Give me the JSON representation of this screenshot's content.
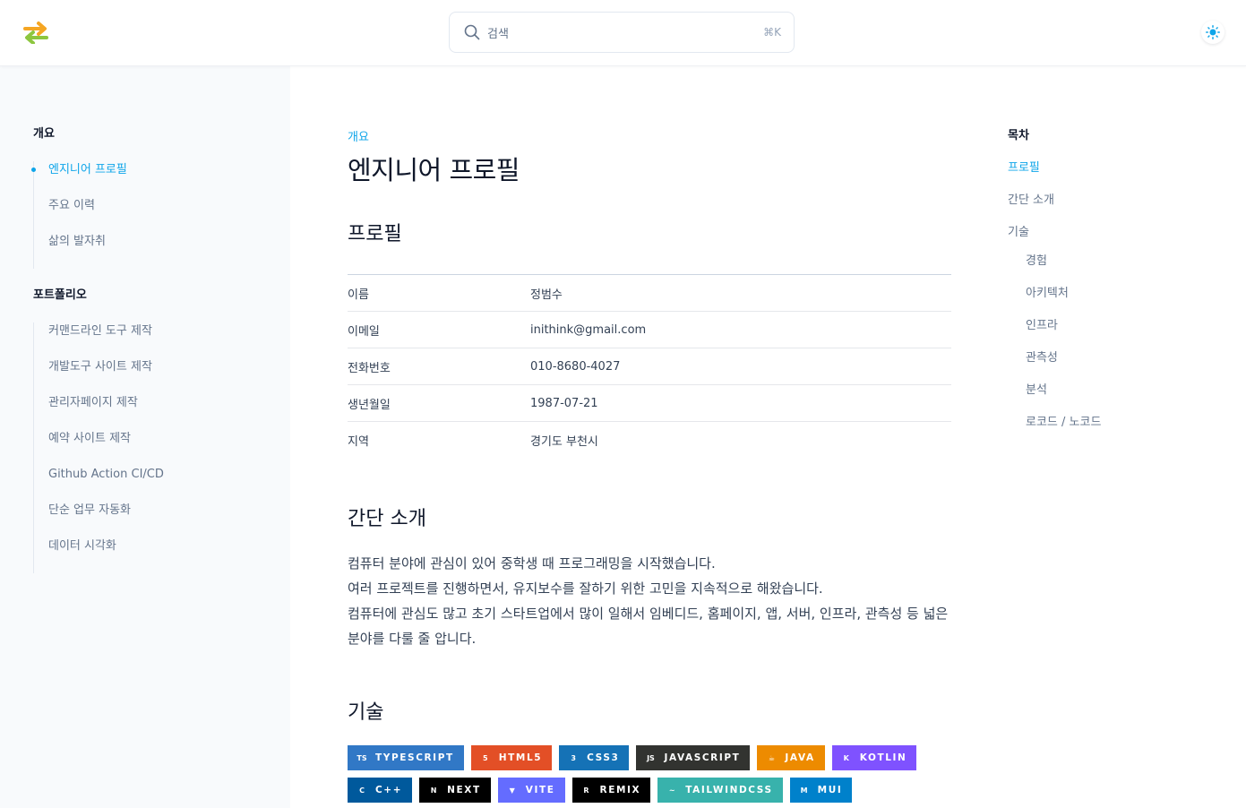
{
  "header": {
    "logo_name": "swap-arrows-logo",
    "search": {
      "placeholder": "검색",
      "shortcut": "⌘K"
    },
    "theme_icon": "sun-icon"
  },
  "sidebar": {
    "sections": [
      {
        "heading": "개요",
        "items": [
          {
            "label": "엔지니어 프로필",
            "active": true
          },
          {
            "label": "주요 이력"
          },
          {
            "label": "삶의 발자취"
          }
        ]
      },
      {
        "heading": "포트폴리오",
        "items": [
          {
            "label": "커맨드라인 도구 제작"
          },
          {
            "label": "개발도구 사이트 제작"
          },
          {
            "label": "관리자페이지 제작"
          },
          {
            "label": "예약 사이트 제작"
          },
          {
            "label": "Github Action CI/CD"
          },
          {
            "label": "단순 업무 자동화"
          },
          {
            "label": "데이터 시각화"
          }
        ]
      }
    ]
  },
  "main": {
    "eyebrow": "개요",
    "title": "엔지니어 프로필",
    "profile_heading": "프로필",
    "profile_rows": [
      {
        "key": "이름",
        "value": "정범수"
      },
      {
        "key": "이메일",
        "value": "inithink@gmail.com"
      },
      {
        "key": "전화번호",
        "value": "010-8680-4027"
      },
      {
        "key": "생년월일",
        "value": "1987-07-21"
      },
      {
        "key": "지역",
        "value": "경기도 부천시"
      }
    ],
    "intro_heading": "간단 소개",
    "intro_lines": [
      "컴퓨터 분야에 관심이 있어 중학생 때 프로그래밍을 시작했습니다.",
      "여러 프로젝트를 진행하면서, 유지보수를 잘하기 위한 고민을 지속적으로 해왔습니다.",
      "컴퓨터에 관심도 많고 초기 스타트업에서 많이 일해서 임베디드, 홈페이지, 앱, 서버, 인프라, 관측성 등 넓은",
      "분야를 다룰 줄 압니다."
    ],
    "tech_heading": "기술",
    "badges": [
      [
        {
          "label": "TYPESCRIPT",
          "color": "#3178c6",
          "icon": "typescript-icon",
          "glyph": "TS"
        },
        {
          "label": "HTML5",
          "color": "#e34f26",
          "icon": "html5-icon",
          "glyph": "5"
        },
        {
          "label": "CSS3",
          "color": "#1572b6",
          "icon": "css3-icon",
          "glyph": "3"
        },
        {
          "label": "JAVASCRIPT",
          "color": "#323330",
          "icon": "javascript-icon",
          "glyph": "JS"
        },
        {
          "label": "JAVA",
          "color": "#ed8b00",
          "icon": "java-icon",
          "glyph": "☕"
        },
        {
          "label": "KOTLIN",
          "color": "#7f52ff",
          "icon": "kotlin-icon",
          "glyph": "K"
        }
      ],
      [
        {
          "label": "C++",
          "color": "#00599c",
          "icon": "cplusplus-icon",
          "glyph": "C"
        },
        {
          "label": "NEXT",
          "color": "#000000",
          "icon": "nextjs-icon",
          "glyph": "N"
        },
        {
          "label": "VITE",
          "color": "#646cff",
          "icon": "vite-icon",
          "glyph": "▼"
        },
        {
          "label": "REMIX",
          "color": "#000000",
          "icon": "remix-icon",
          "glyph": "R"
        },
        {
          "label": "TAILWINDCSS",
          "color": "#38b2ac",
          "icon": "tailwind-icon",
          "glyph": "~"
        },
        {
          "label": "MUI",
          "color": "#0081cb",
          "icon": "mui-icon",
          "glyph": "M"
        }
      ]
    ]
  },
  "toc": {
    "heading": "목차",
    "items": [
      {
        "label": "프로필",
        "level": 1,
        "active": true
      },
      {
        "label": "간단 소개",
        "level": 1
      },
      {
        "label": "기술",
        "level": 1
      },
      {
        "label": "경험",
        "level": 2
      },
      {
        "label": "아키텍처",
        "level": 2
      },
      {
        "label": "인프라",
        "level": 2
      },
      {
        "label": "관측성",
        "level": 2
      },
      {
        "label": "분석",
        "level": 2
      },
      {
        "label": "로코드 / 노코드",
        "level": 2
      }
    ]
  },
  "colors": {
    "accent": "#0ea5e9",
    "logo_orange": "#f5a623",
    "logo_green": "#8dc63f",
    "sidebar_bg": "#f8fafc"
  }
}
